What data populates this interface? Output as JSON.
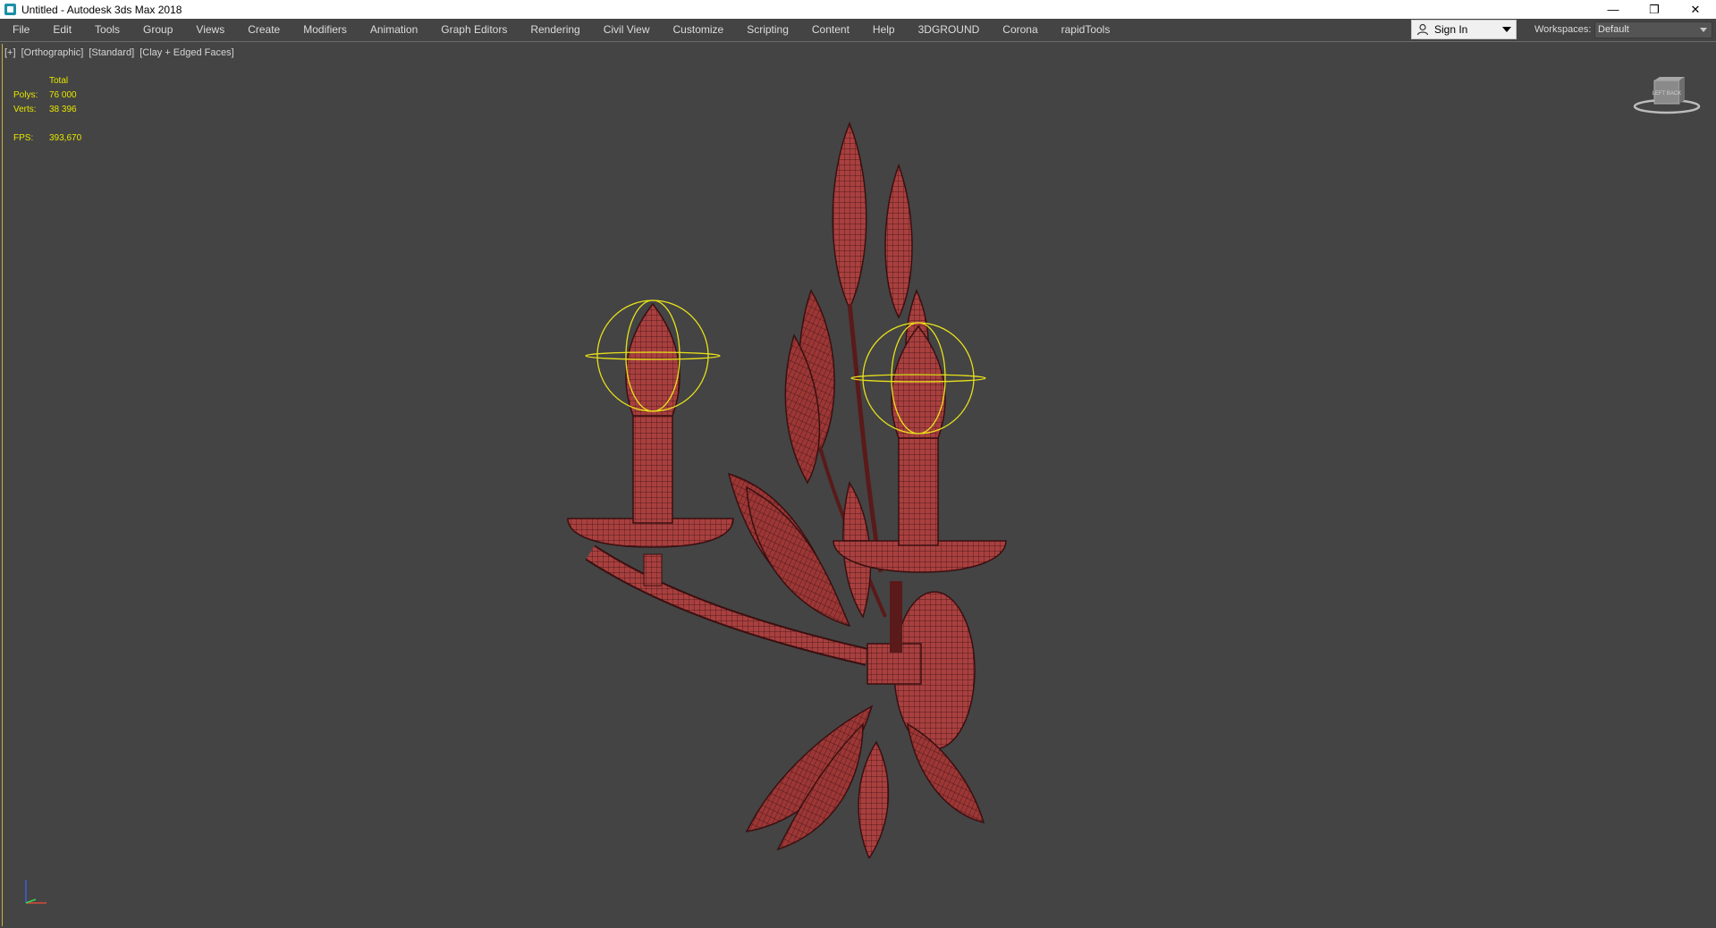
{
  "window": {
    "title": "Untitled - Autodesk 3ds Max 2018",
    "controls": [
      "minimize",
      "restore",
      "close"
    ]
  },
  "menubar": {
    "items": [
      "File",
      "Edit",
      "Tools",
      "Group",
      "Views",
      "Create",
      "Modifiers",
      "Animation",
      "Graph Editors",
      "Rendering",
      "Civil View",
      "Customize",
      "Scripting",
      "Content",
      "Help",
      "3DGROUND",
      "Corona",
      "rapidTools"
    ],
    "sign_in": "Sign In",
    "workspaces_label": "Workspaces:",
    "workspace_value": "Default"
  },
  "viewport": {
    "labels": [
      "[+]",
      "[Orthographic]",
      "[Standard]",
      "[Clay + Edged Faces]"
    ],
    "stats": {
      "header": "Total",
      "polys_label": "Polys:",
      "polys_value": "76 000",
      "verts_label": "Verts:",
      "verts_value": "38 396",
      "fps_label": "FPS:",
      "fps_value": "393,670"
    },
    "viewcube_icon": "viewcube-icon",
    "axis_icon": "axis-tripod-icon"
  },
  "colors": {
    "viewport_bg": "#444444",
    "model": "#a8403f",
    "wire": "#3a0f10",
    "selection": "#e8e21a",
    "stats_text": "#e6e600"
  }
}
